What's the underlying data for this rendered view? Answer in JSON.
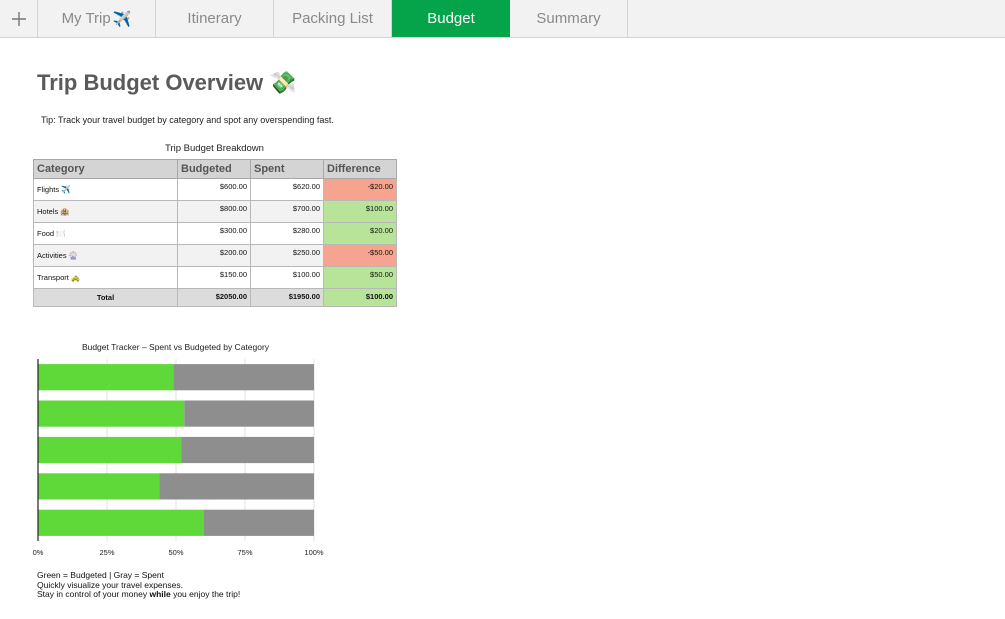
{
  "tabs": [
    {
      "label": "My Trip",
      "emoji": "✈️"
    },
    {
      "label": "Itinerary"
    },
    {
      "label": "Packing List"
    },
    {
      "label": "Budget",
      "active": true
    },
    {
      "label": "Summary"
    }
  ],
  "page": {
    "title": "Trip Budget Overview 💸",
    "tip": "Tip: Track your travel budget by category and spot any overspending fast."
  },
  "table": {
    "caption": "Trip Budget Breakdown",
    "headers": [
      "Category",
      "Budgeted",
      "Spent",
      "Difference"
    ],
    "rows": [
      {
        "category": "Flights ✈️",
        "budgeted": "$600.00",
        "spent": "$620.00",
        "difference": "-$20.00",
        "status": "over"
      },
      {
        "category": "Hotels 🏨",
        "budgeted": "$800.00",
        "spent": "$700.00",
        "difference": "$100.00",
        "status": "under"
      },
      {
        "category": "Food 🍽️",
        "budgeted": "$300.00",
        "spent": "$280.00",
        "difference": "$20.00",
        "status": "under"
      },
      {
        "category": "Activities 🎡",
        "budgeted": "$200.00",
        "spent": "$250.00",
        "difference": "-$50.00",
        "status": "over"
      },
      {
        "category": "Transport 🚕",
        "budgeted": "$150.00",
        "spent": "$100.00",
        "difference": "$50.00",
        "status": "under"
      }
    ],
    "total": {
      "label": "Total",
      "budgeted": "$2050.00",
      "spent": "$1950.00",
      "difference": "$100.00"
    }
  },
  "colors": {
    "accent": "#05a44b",
    "over": "#f6a48f",
    "under": "#b8e49a",
    "bar_green": "#5fd93a",
    "bar_gray": "#8e8e8e"
  },
  "chart_data": {
    "type": "bar",
    "orientation": "horizontal",
    "stacked": true,
    "title": "Budget Tracker – Spent vs Budgeted by Category",
    "rows": 5,
    "series": [
      {
        "values": [
          49,
          53,
          52,
          44,
          60
        ],
        "color": "#5fd93a"
      },
      {
        "values": [
          51,
          47,
          48,
          56,
          40
        ],
        "color": "#8e8e8e"
      }
    ],
    "xlim": [
      0,
      100
    ],
    "xticks": [
      "0%",
      "25%",
      "50%",
      "75%",
      "100%"
    ],
    "grid": true,
    "legend_position": "none"
  },
  "footer": {
    "line1": "Green = Budgeted | Gray = Spent",
    "line2": "Quickly visualize your travel expenses.",
    "line3_before": "Stay in control of your money ",
    "line3_bold": "while",
    "line3_after": " you enjoy the trip!"
  }
}
